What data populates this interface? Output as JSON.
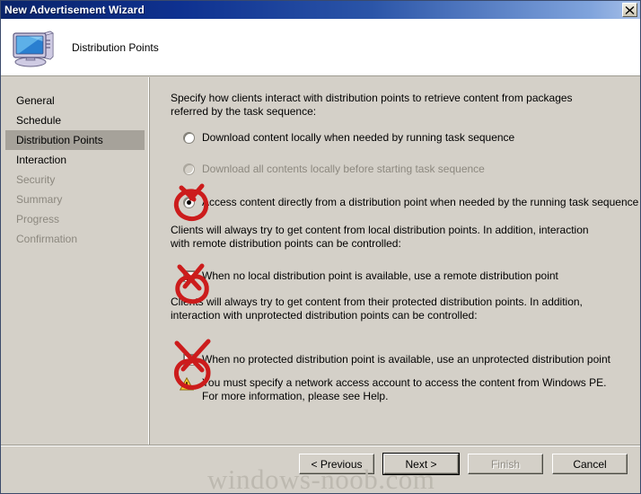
{
  "window": {
    "title": "New Advertisement Wizard",
    "close_icon": "close-icon"
  },
  "header": {
    "icon": "computer-icon",
    "title": "Distribution Points"
  },
  "sidebar": {
    "items": [
      {
        "label": "General",
        "state": "enabled"
      },
      {
        "label": "Schedule",
        "state": "enabled"
      },
      {
        "label": "Distribution Points",
        "state": "selected"
      },
      {
        "label": "Interaction",
        "state": "enabled"
      },
      {
        "label": "Security",
        "state": "disabled"
      },
      {
        "label": "Summary",
        "state": "disabled"
      },
      {
        "label": "Progress",
        "state": "disabled"
      },
      {
        "label": "Confirmation",
        "state": "disabled"
      }
    ]
  },
  "content": {
    "intro": "Specify how clients interact with distribution points to retrieve content from packages referred by the task sequence:",
    "radios": [
      {
        "label": "Download content locally when needed by running task sequence",
        "checked": false,
        "disabled": false
      },
      {
        "label": "Download all contents locally before starting task sequence",
        "checked": false,
        "disabled": true
      },
      {
        "label": "Access content directly from a distribution point when needed by the running task sequence",
        "checked": true,
        "disabled": false
      }
    ],
    "local_para": "Clients will always try to get content from local distribution points. In addition, interaction with remote distribution points can be controlled:",
    "local_checkbox": {
      "label": "When no local distribution point is available, use a remote distribution point",
      "checked": true
    },
    "protected_para": "Clients will always try to get content from their protected distribution points. In addition, interaction with unprotected distribution points can be controlled:",
    "protected_checkbox": {
      "label": "When no protected distribution point is available, use an unprotected distribution point",
      "checked": true
    },
    "warning": {
      "icon": "warning-triangle-icon",
      "text": "You must specify a network access account to access the content from Windows PE.  For more information, please see Help."
    }
  },
  "footer": {
    "buttons": [
      {
        "label": "< Previous",
        "state": "enabled"
      },
      {
        "label": "Next >",
        "state": "default"
      },
      {
        "label": "Finish",
        "state": "disabled"
      },
      {
        "label": "Cancel",
        "state": "enabled"
      }
    ]
  },
  "watermark": {
    "text": "windows-noob.com"
  },
  "annotations": {
    "color": "#cc1c1c",
    "marks": [
      {
        "name": "annotation-circle-radio-access-content",
        "shape": "circle-x"
      },
      {
        "name": "annotation-circle-checkbox-remote-dp",
        "shape": "circle-x"
      },
      {
        "name": "annotation-circle-checkbox-unprotected-dp",
        "shape": "circle-x"
      }
    ]
  }
}
